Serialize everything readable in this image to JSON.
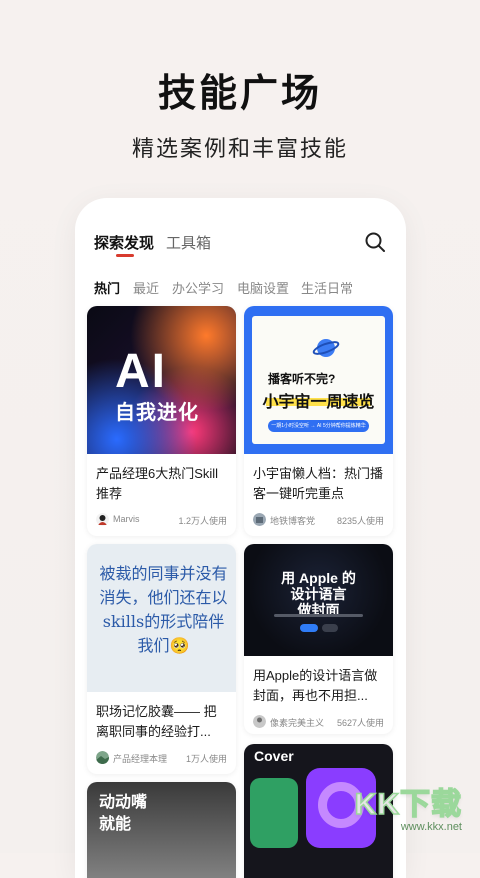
{
  "hero": {
    "title": "技能广场",
    "subtitle": "精选案例和丰富技能"
  },
  "topbar": {
    "tab_explore": "探索发现",
    "tab_tools": "工具箱"
  },
  "categories": [
    "热门",
    "最近",
    "办公学习",
    "电脑设置",
    "生活日常"
  ],
  "cards": [
    {
      "thumb_big": "AI",
      "thumb_sub": "自我进化",
      "title": "产品经理6大热门Skill推荐",
      "author": "Marvis",
      "uses": "1.2万人使用"
    },
    {
      "thumb_line1": "播客听不完?",
      "thumb_line2": "小宇宙一周速览",
      "thumb_pill": "一期1小时没空听 → AI 5分钟帮你提炼精华",
      "title": "小宇宙懒人档：热门播客一键听完重点",
      "author": "地铁博客党",
      "uses": "8235人使用"
    },
    {
      "thumb_text": "被裁的同事并没有消失，他们还在以skills的形式陪伴我们🥺",
      "title": "职场记忆胶囊—— 把离职同事的经验打...",
      "author": "产品经理本理",
      "uses": "1万人使用"
    },
    {
      "thumb_line1": "用 Apple 的",
      "thumb_line2": "设计语言",
      "thumb_line3": "做封面",
      "title": "用Apple的设计语言做封面，再也不用担...",
      "author": "像素完美主义",
      "uses": "5627人使用"
    },
    {
      "thumb_text": "动动嘴\n就能"
    },
    {
      "thumb_text": "Cover"
    }
  ],
  "watermark": {
    "main": "KK下载",
    "sub": "www.kkx.net"
  },
  "colors": {
    "accent": "#d83b2e",
    "background": "#f6f1ef"
  }
}
